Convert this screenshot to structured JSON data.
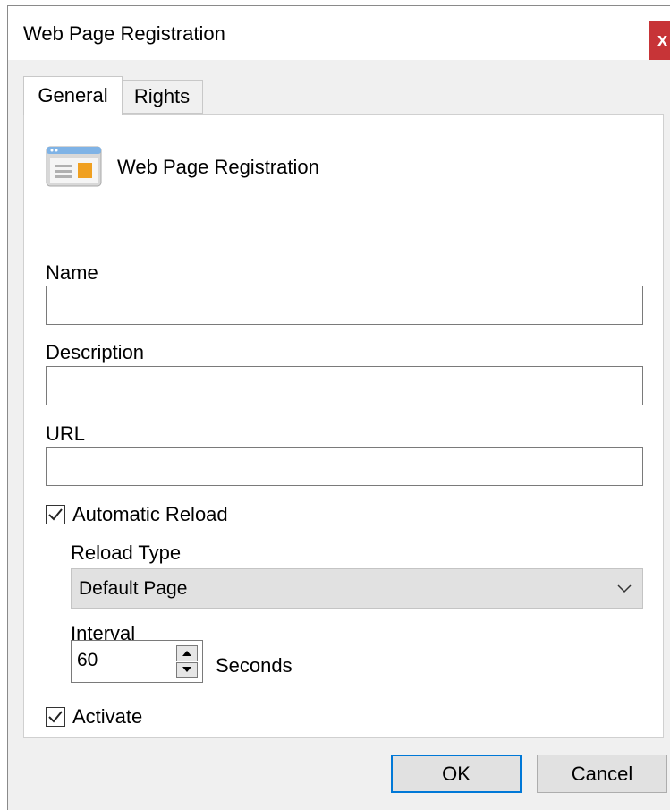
{
  "window": {
    "title": "Web Page Registration",
    "close_label": "x"
  },
  "tabs": [
    {
      "label": "General",
      "selected": true
    },
    {
      "label": "Rights",
      "selected": false
    }
  ],
  "header": {
    "icon": "web-page-icon",
    "title": "Web Page Registration"
  },
  "form": {
    "name": {
      "label": "Name",
      "value": ""
    },
    "description": {
      "label": "Description",
      "value": ""
    },
    "url": {
      "label": "URL",
      "value": ""
    },
    "automatic_reload": {
      "label": "Automatic Reload",
      "checked": true
    },
    "reload_type": {
      "label": "Reload Type",
      "value": "Default Page"
    },
    "interval": {
      "label": "Interval",
      "value": "60",
      "unit": "Seconds"
    },
    "activate": {
      "label": "Activate",
      "checked": true
    }
  },
  "buttons": {
    "ok": "OK",
    "cancel": "Cancel"
  },
  "colors": {
    "close": "#c73437",
    "focus_border": "#0078d7",
    "icon_accent": "#f0a020"
  }
}
